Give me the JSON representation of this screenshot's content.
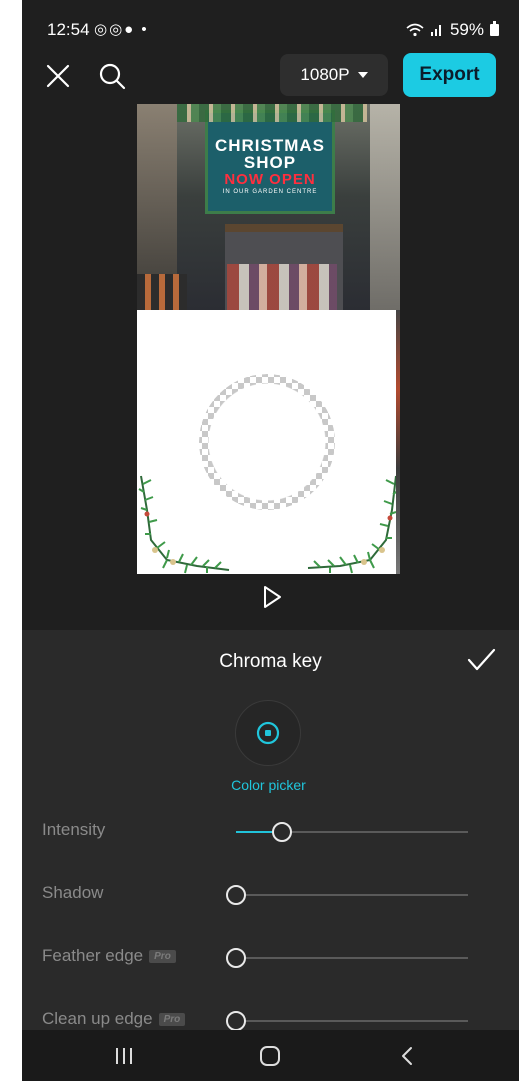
{
  "status_bar": {
    "time": "12:54",
    "left_icons": "◎◎● •",
    "battery": "59%"
  },
  "toolbar": {
    "resolution": "1080P",
    "export_label": "Export"
  },
  "preview": {
    "sign_line1": "CHRISTMAS",
    "sign_line2": "SHOP",
    "sign_line3": "NOW OPEN",
    "sign_line4": "IN OUR GARDEN CENTRE"
  },
  "panel": {
    "title": "Chroma key",
    "color_picker_label": "Color picker",
    "params": [
      {
        "label": "Intensity",
        "value_fraction": 0.2,
        "pro": false
      },
      {
        "label": "Shadow",
        "value_fraction": 0.0,
        "pro": false
      },
      {
        "label": "Feather edge",
        "value_fraction": 0.0,
        "pro": true,
        "badge": "Pro"
      },
      {
        "label": "Clean up edge",
        "value_fraction": 0.0,
        "pro": true,
        "badge": "Pro"
      }
    ]
  },
  "colors": {
    "accent": "#1ccbe3",
    "panel_bg": "#2a2a2a",
    "editor_bg": "#1f1f1f"
  },
  "icons": [
    "close-icon",
    "search-icon",
    "chevron-down-icon",
    "play-icon",
    "check-icon",
    "color-picker-icon",
    "recent-apps-icon",
    "home-icon",
    "back-icon"
  ]
}
